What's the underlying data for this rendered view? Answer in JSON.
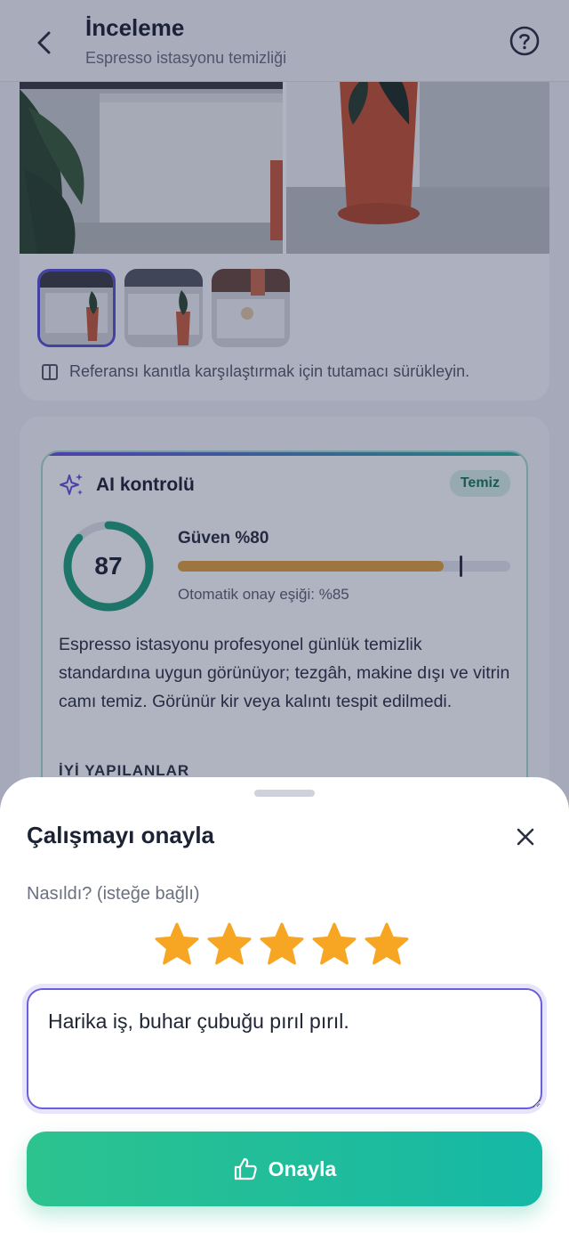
{
  "header": {
    "title": "İnceleme",
    "subtitle": "Espresso istasyonu temizliği"
  },
  "photos": {
    "thumbnail_count": 3,
    "hint": "Referansı kanıtla karşılaştırmak için tutamacı sürükleyin."
  },
  "ai_check": {
    "title": "AI kontrolü",
    "status_badge": "Temiz",
    "score": "87",
    "score_value": 87,
    "confidence_label": "Güven %80",
    "confidence_value": 0.8,
    "threshold_label": "Otomatik onay eşiği: %85",
    "threshold_value": 0.85,
    "summary": "Espresso istasyonu profesyonel günlük temizlik standardına uygun görünüyor; tezgâh, makine dışı ve vitrin camı temiz. Görünür kir veya kalıntı tespit edilmedi.",
    "good_label": "İYİ YAPILANLAR"
  },
  "sheet": {
    "title": "Çalışmayı onayla",
    "rating_label": "Nasıldı? (isteğe bağlı)",
    "rating_value": 5,
    "rating_max": 5,
    "comment_value": "Harika iş, buhar çubuğu pırıl pırıl.",
    "approve_label": "Onayla"
  },
  "colors": {
    "accent": "#5b52d6",
    "success": "#1fa27a",
    "warning": "#e2a33c",
    "star": "#f6a623",
    "approve_gradient_start": "#2cc38f",
    "approve_gradient_end": "#16b8a6"
  },
  "icons": {
    "back": "chevron-left-icon",
    "help": "question-circle-icon",
    "compare": "split-view-icon",
    "ai": "sparkles-icon",
    "close": "close-icon",
    "star": "star-icon",
    "approve": "thumbs-up-icon"
  }
}
